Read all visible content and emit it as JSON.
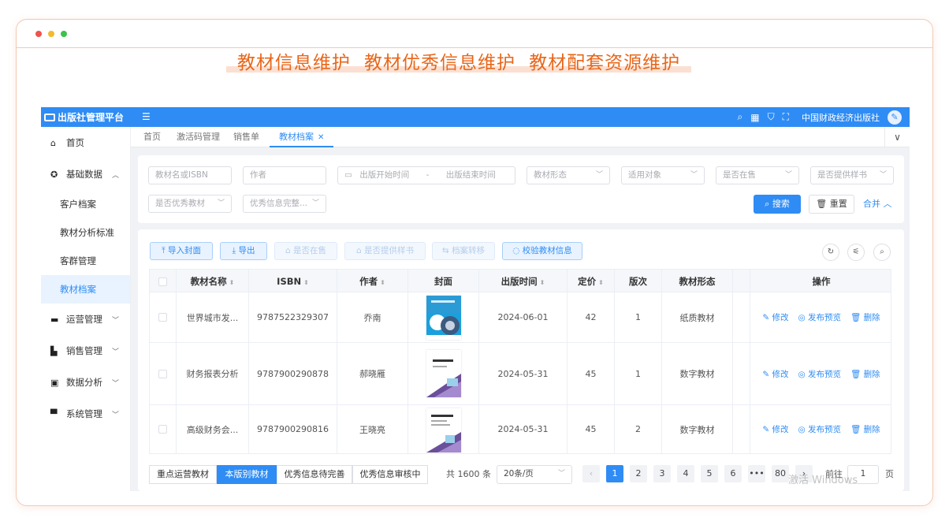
{
  "headline": [
    "教材信息维护",
    "教材优秀信息维护",
    "教材配套资源维护"
  ],
  "topbar": {
    "brand": "出版社管理平台",
    "publisher": "中国财政经济出版社",
    "icons": [
      "search-icon",
      "grid-icon",
      "shirt-icon",
      "fullscreen-icon"
    ]
  },
  "sidebar": {
    "home": "首页",
    "basic": "基础数据",
    "sub": [
      "客户档案",
      "教材分析标准",
      "客群管理",
      "教材档案"
    ],
    "active_sub": "教材档案",
    "groups": [
      "运营管理",
      "销售管理",
      "数据分析",
      "系统管理"
    ]
  },
  "tabs": [
    "首页",
    "激活码管理",
    "销售单",
    "教材档案"
  ],
  "filters": {
    "name_isbn": "教材名或ISBN",
    "author": "作者",
    "date_start": "出版开始时间",
    "date_sep": "-",
    "date_end": "出版结束时间",
    "form": "教材形态",
    "target": "适用对象",
    "on_sale": "是否在售",
    "sample": "是否提供样书",
    "excellent": "是否优秀教材",
    "complete": "优秀信息完整...",
    "search": "搜索",
    "reset": "重置",
    "collapse": "合并"
  },
  "toolbar": [
    "导入封面",
    "导出",
    "是否在售",
    "是否提供样书",
    "档案转移",
    "校验教材信息"
  ],
  "table": {
    "headers": [
      "教材名称",
      "ISBN",
      "作者",
      "封面",
      "出版时间",
      "定价",
      "版次",
      "教材形态",
      "操作"
    ],
    "rows": [
      {
        "name": "世界城市发...",
        "isbn": "9787522329307",
        "author": "乔南",
        "date": "2024-06-01",
        "price": "42",
        "edition": "1",
        "form": "纸质教材"
      },
      {
        "name": "财务报表分析",
        "isbn": "9787900290878",
        "author": "郝晓雁",
        "date": "2024-05-31",
        "price": "45",
        "edition": "1",
        "form": "数字教材"
      },
      {
        "name": "高级财务会...",
        "isbn": "9787900290816",
        "author": "王晓亮",
        "date": "2024-05-31",
        "price": "45",
        "edition": "2",
        "form": "数字教材"
      }
    ],
    "ops": [
      "修改",
      "发布预览",
      "删除"
    ]
  },
  "bottom_tabs": [
    "重点运营教材",
    "本版别教材",
    "优秀信息待完善",
    "优秀信息审核中"
  ],
  "pager": {
    "total": "共 1600 条",
    "size": "20条/页",
    "pages": [
      "1",
      "2",
      "3",
      "4",
      "5",
      "6",
      "•••",
      "80"
    ],
    "goto": "前往",
    "page_value": "1",
    "page_unit": "页"
  },
  "watermark": "激活 Windows",
  "colors": {
    "primary": "#2f8cf4",
    "accent": "#e8661a"
  }
}
